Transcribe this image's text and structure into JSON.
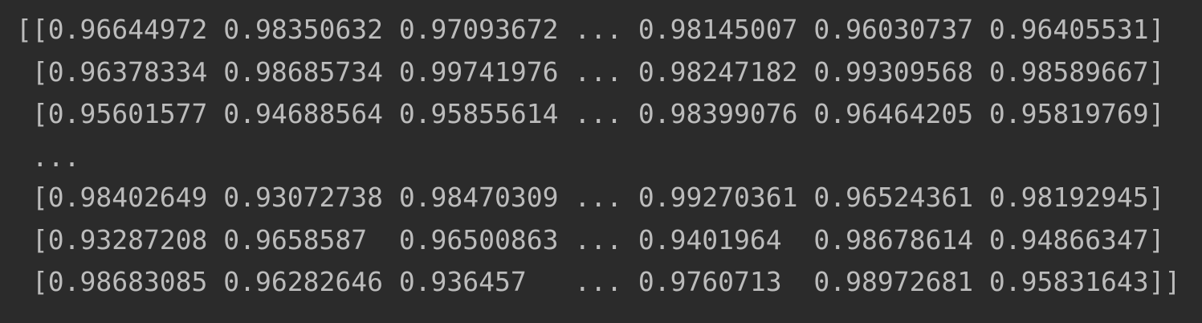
{
  "console": {
    "clipped_line": "  ) ]",
    "lines": [
      "[[0.96644972 0.98350632 0.97093672 ... 0.98145007 0.96030737 0.96405531]",
      " [0.96378334 0.98685734 0.99741976 ... 0.98247182 0.99309568 0.98589667]",
      " [0.95601577 0.94688564 0.95855614 ... 0.98399076 0.96464205 0.95819769]",
      " ...",
      " [0.98402649 0.93072738 0.98470309 ... 0.99270361 0.96524361 0.98192945]",
      " [0.93287208 0.9658587  0.96500863 ... 0.9401964  0.98678614 0.94866347]",
      " [0.98683085 0.96282646 0.936457   ... 0.9760713  0.98972681 0.95831643]]"
    ]
  }
}
